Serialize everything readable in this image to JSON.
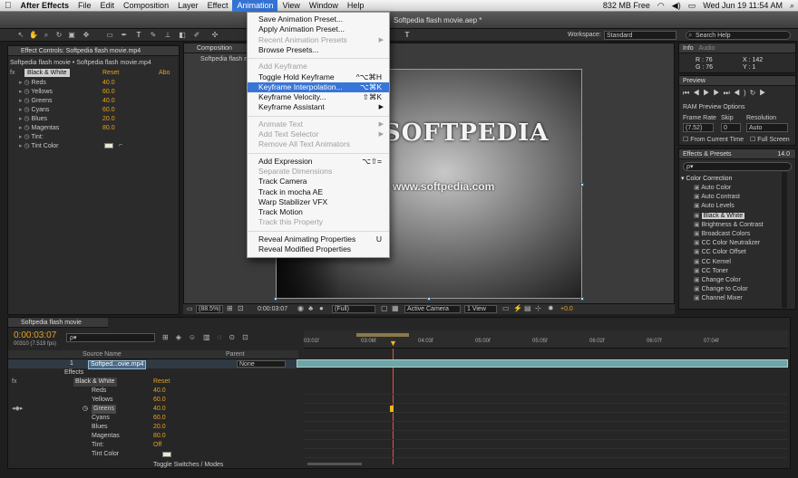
{
  "menubar": {
    "apple_icon": "apple-icon",
    "app": "After Effects",
    "items": [
      "File",
      "Edit",
      "Composition",
      "Layer",
      "Effect",
      "Animation",
      "View",
      "Window",
      "Help"
    ],
    "active": "Animation",
    "memory": "832 MB Free",
    "datetime": "Wed Jun 19  11:54 AM"
  },
  "title": {
    "file": "Softpedia flash movie.aep *"
  },
  "workspace": {
    "label": "Workspace:",
    "value": "Standard",
    "search_placeholder": "Search Help"
  },
  "effect_controls": {
    "tab": "Effect Controls: Softpedia flash movie.mp4",
    "breadcrumb": "Softpedia flash movie • Softpedia flash movie.mp4",
    "effect_name": "Black & White",
    "reset": "Reset",
    "about": "Abo",
    "params": [
      {
        "name": "Reds",
        "value": "40.0"
      },
      {
        "name": "Yellows",
        "value": "60.0"
      },
      {
        "name": "Greens",
        "value": "40.0"
      },
      {
        "name": "Cyans",
        "value": "60.0"
      },
      {
        "name": "Blues",
        "value": "20.0"
      },
      {
        "name": "Magentas",
        "value": "80.0"
      },
      {
        "name": "Tint:",
        "value": ""
      },
      {
        "name": "Tint Color",
        "value": ""
      }
    ]
  },
  "composition": {
    "tab": "Composition",
    "sub": "Softpedia flash m",
    "frame_text": "SOFTPEDIA",
    "frame_url": "www.softpedia.com"
  },
  "viewer_footer": {
    "zoom": "(88.5%)",
    "time": "0:00:03:07",
    "res": "(Full)",
    "camera": "Active Camera",
    "view": "1 View",
    "exposure": "+0.0"
  },
  "animation_menu": [
    {
      "label": "Save Animation Preset...",
      "state": "normal",
      "shortcut": ""
    },
    {
      "label": "Apply Animation Preset...",
      "state": "normal",
      "shortcut": ""
    },
    {
      "label": "Recent Animation Presets",
      "state": "disabled",
      "shortcut": "",
      "submenu": true
    },
    {
      "label": "Browse Presets...",
      "state": "normal",
      "shortcut": ""
    },
    {
      "sep": true
    },
    {
      "label": "Add Keyframe",
      "state": "disabled",
      "shortcut": ""
    },
    {
      "label": "Toggle Hold Keyframe",
      "state": "normal",
      "shortcut": "^⌥⌘H"
    },
    {
      "label": "Keyframe Interpolation...",
      "state": "highlighted",
      "shortcut": "⌥⌘K"
    },
    {
      "label": "Keyframe Velocity...",
      "state": "normal",
      "shortcut": "⇧⌘K"
    },
    {
      "label": "Keyframe Assistant",
      "state": "normal",
      "shortcut": "",
      "submenu": true
    },
    {
      "sep": true
    },
    {
      "label": "Animate Text",
      "state": "disabled",
      "shortcut": "",
      "submenu": true
    },
    {
      "label": "Add Text Selector",
      "state": "disabled",
      "shortcut": "",
      "submenu": true
    },
    {
      "label": "Remove All Text Animators",
      "state": "disabled",
      "shortcut": ""
    },
    {
      "sep": true
    },
    {
      "label": "Add Expression",
      "state": "normal",
      "shortcut": "⌥⇧="
    },
    {
      "label": "Separate Dimensions",
      "state": "disabled",
      "shortcut": ""
    },
    {
      "label": "Track Camera",
      "state": "normal",
      "shortcut": ""
    },
    {
      "label": "Track in mocha AE",
      "state": "normal",
      "shortcut": ""
    },
    {
      "label": "Warp Stabilizer VFX",
      "state": "normal",
      "shortcut": ""
    },
    {
      "label": "Track Motion",
      "state": "normal",
      "shortcut": ""
    },
    {
      "label": "Track this Property",
      "state": "disabled",
      "shortcut": ""
    },
    {
      "sep": true
    },
    {
      "label": "Reveal Animating Properties",
      "state": "normal",
      "shortcut": "U"
    },
    {
      "label": "Reveal Modified Properties",
      "state": "normal",
      "shortcut": ""
    }
  ],
  "info": {
    "tab": "Info",
    "tab2": "Audio",
    "r": "R : 76",
    "g": "G : 76",
    "x": "X : 142",
    "y": "Y : 1"
  },
  "preview": {
    "tab": "Preview",
    "ram": "RAM Preview Options",
    "frame_rate": "Frame Rate",
    "skip": "Skip",
    "resolution": "Resolution",
    "fr_value": "(7.52)",
    "skip_value": "0",
    "res_value": "Auto",
    "from_current": "From Current Time",
    "full_screen": "Full Screen"
  },
  "effects_presets": {
    "tab": "Effects & Presets",
    "version": "14.0",
    "search_placeholder": "ρ▾",
    "category": "Color Correction",
    "items": [
      "Auto Color",
      "Auto Contrast",
      "Auto Levels",
      "Black & White",
      "Brightness & Contrast",
      "Broadcast Colors",
      "CC Color Neutralizer",
      "CC Color Offset",
      "CC Kernel",
      "CC Toner",
      "Change Color",
      "Change to Color",
      "Channel Mixer"
    ],
    "selected": "Black & White"
  },
  "timeline": {
    "tab": "Softpedia flash movie",
    "timecode": "0:00:03:07",
    "fps": "00310 (7.519 fps)",
    "search_placeholder": "ρ▾",
    "col_source": "Source Name",
    "col_parent": "Parent",
    "layer_num": "1",
    "layer_name": "Softped...ovie.mp4",
    "parent_value": "None",
    "effects_label": "Effects",
    "fx_label": "fx",
    "effect": "Black & White",
    "reset": "Reset",
    "params": [
      {
        "name": "Reds",
        "value": "40.0"
      },
      {
        "name": "Yellows",
        "value": "60.0"
      },
      {
        "name": "Greens",
        "value": "40.0"
      },
      {
        "name": "Cyans",
        "value": "60.0"
      },
      {
        "name": "Blues",
        "value": "20.0"
      },
      {
        "name": "Magentas",
        "value": "80.0"
      },
      {
        "name": "Tint:",
        "value": "Off"
      },
      {
        "name": "Tint Color",
        "value": ""
      }
    ],
    "ruler": [
      "03:01f",
      "03:06f",
      "04:03f",
      "05:00f",
      "05:05f",
      "06:02f",
      "06:07f",
      "07:04f"
    ],
    "toggle": "Toggle Switches / Modes"
  },
  "colors": {
    "accent": "#3875d7",
    "value": "#e6a020",
    "keyframe": "#e6553a"
  }
}
